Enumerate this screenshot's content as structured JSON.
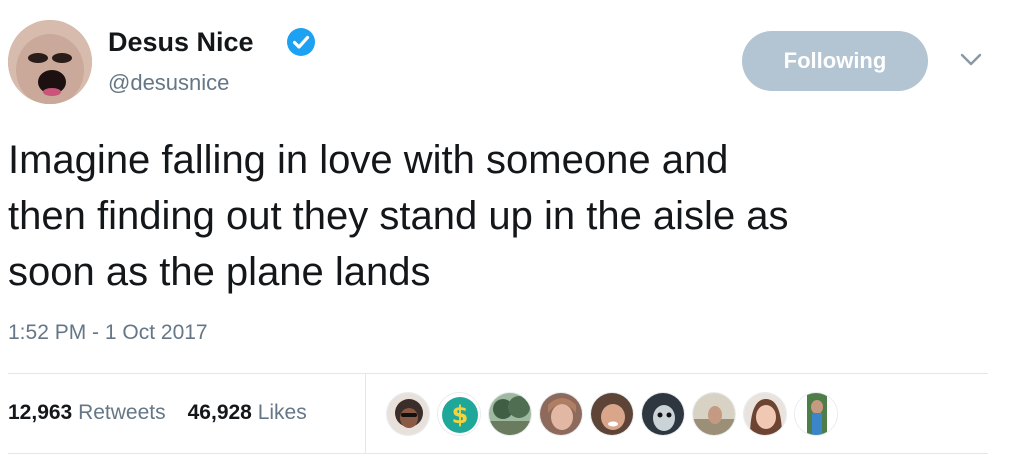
{
  "user": {
    "display_name": "Desus Nice",
    "handle": "@desusnice",
    "verified": true
  },
  "follow_button": {
    "label": "Following"
  },
  "tweet": {
    "lines": [
      "Imagine falling in love with someone and",
      "then finding out they stand up in the aisle as",
      "soon as the plane lands"
    ],
    "timestamp": "1:52 PM - 1 Oct 2017"
  },
  "stats": {
    "retweets_count": "12,963",
    "retweets_label": "Retweets",
    "likes_count": "46,928",
    "likes_label": "Likes"
  },
  "likers": [
    {
      "icon": "liker-avatar-1",
      "color": "#3a2d2a"
    },
    {
      "icon": "liker-avatar-2-dollar",
      "color": "#1fa89a"
    },
    {
      "icon": "liker-avatar-3",
      "color": "#4f6e52"
    },
    {
      "icon": "liker-avatar-4",
      "color": "#c89a86"
    },
    {
      "icon": "liker-avatar-5",
      "color": "#b9866e"
    },
    {
      "icon": "liker-avatar-6",
      "color": "#4d5966"
    },
    {
      "icon": "liker-avatar-7",
      "color": "#b2a58f"
    },
    {
      "icon": "liker-avatar-8",
      "color": "#a56c58"
    },
    {
      "icon": "liker-avatar-9",
      "color": "#4e7d4a"
    }
  ],
  "colors": {
    "verified_badge": "#1da1f2",
    "follow_button_bg": "#b3c4d2",
    "secondary_text": "#657786"
  }
}
